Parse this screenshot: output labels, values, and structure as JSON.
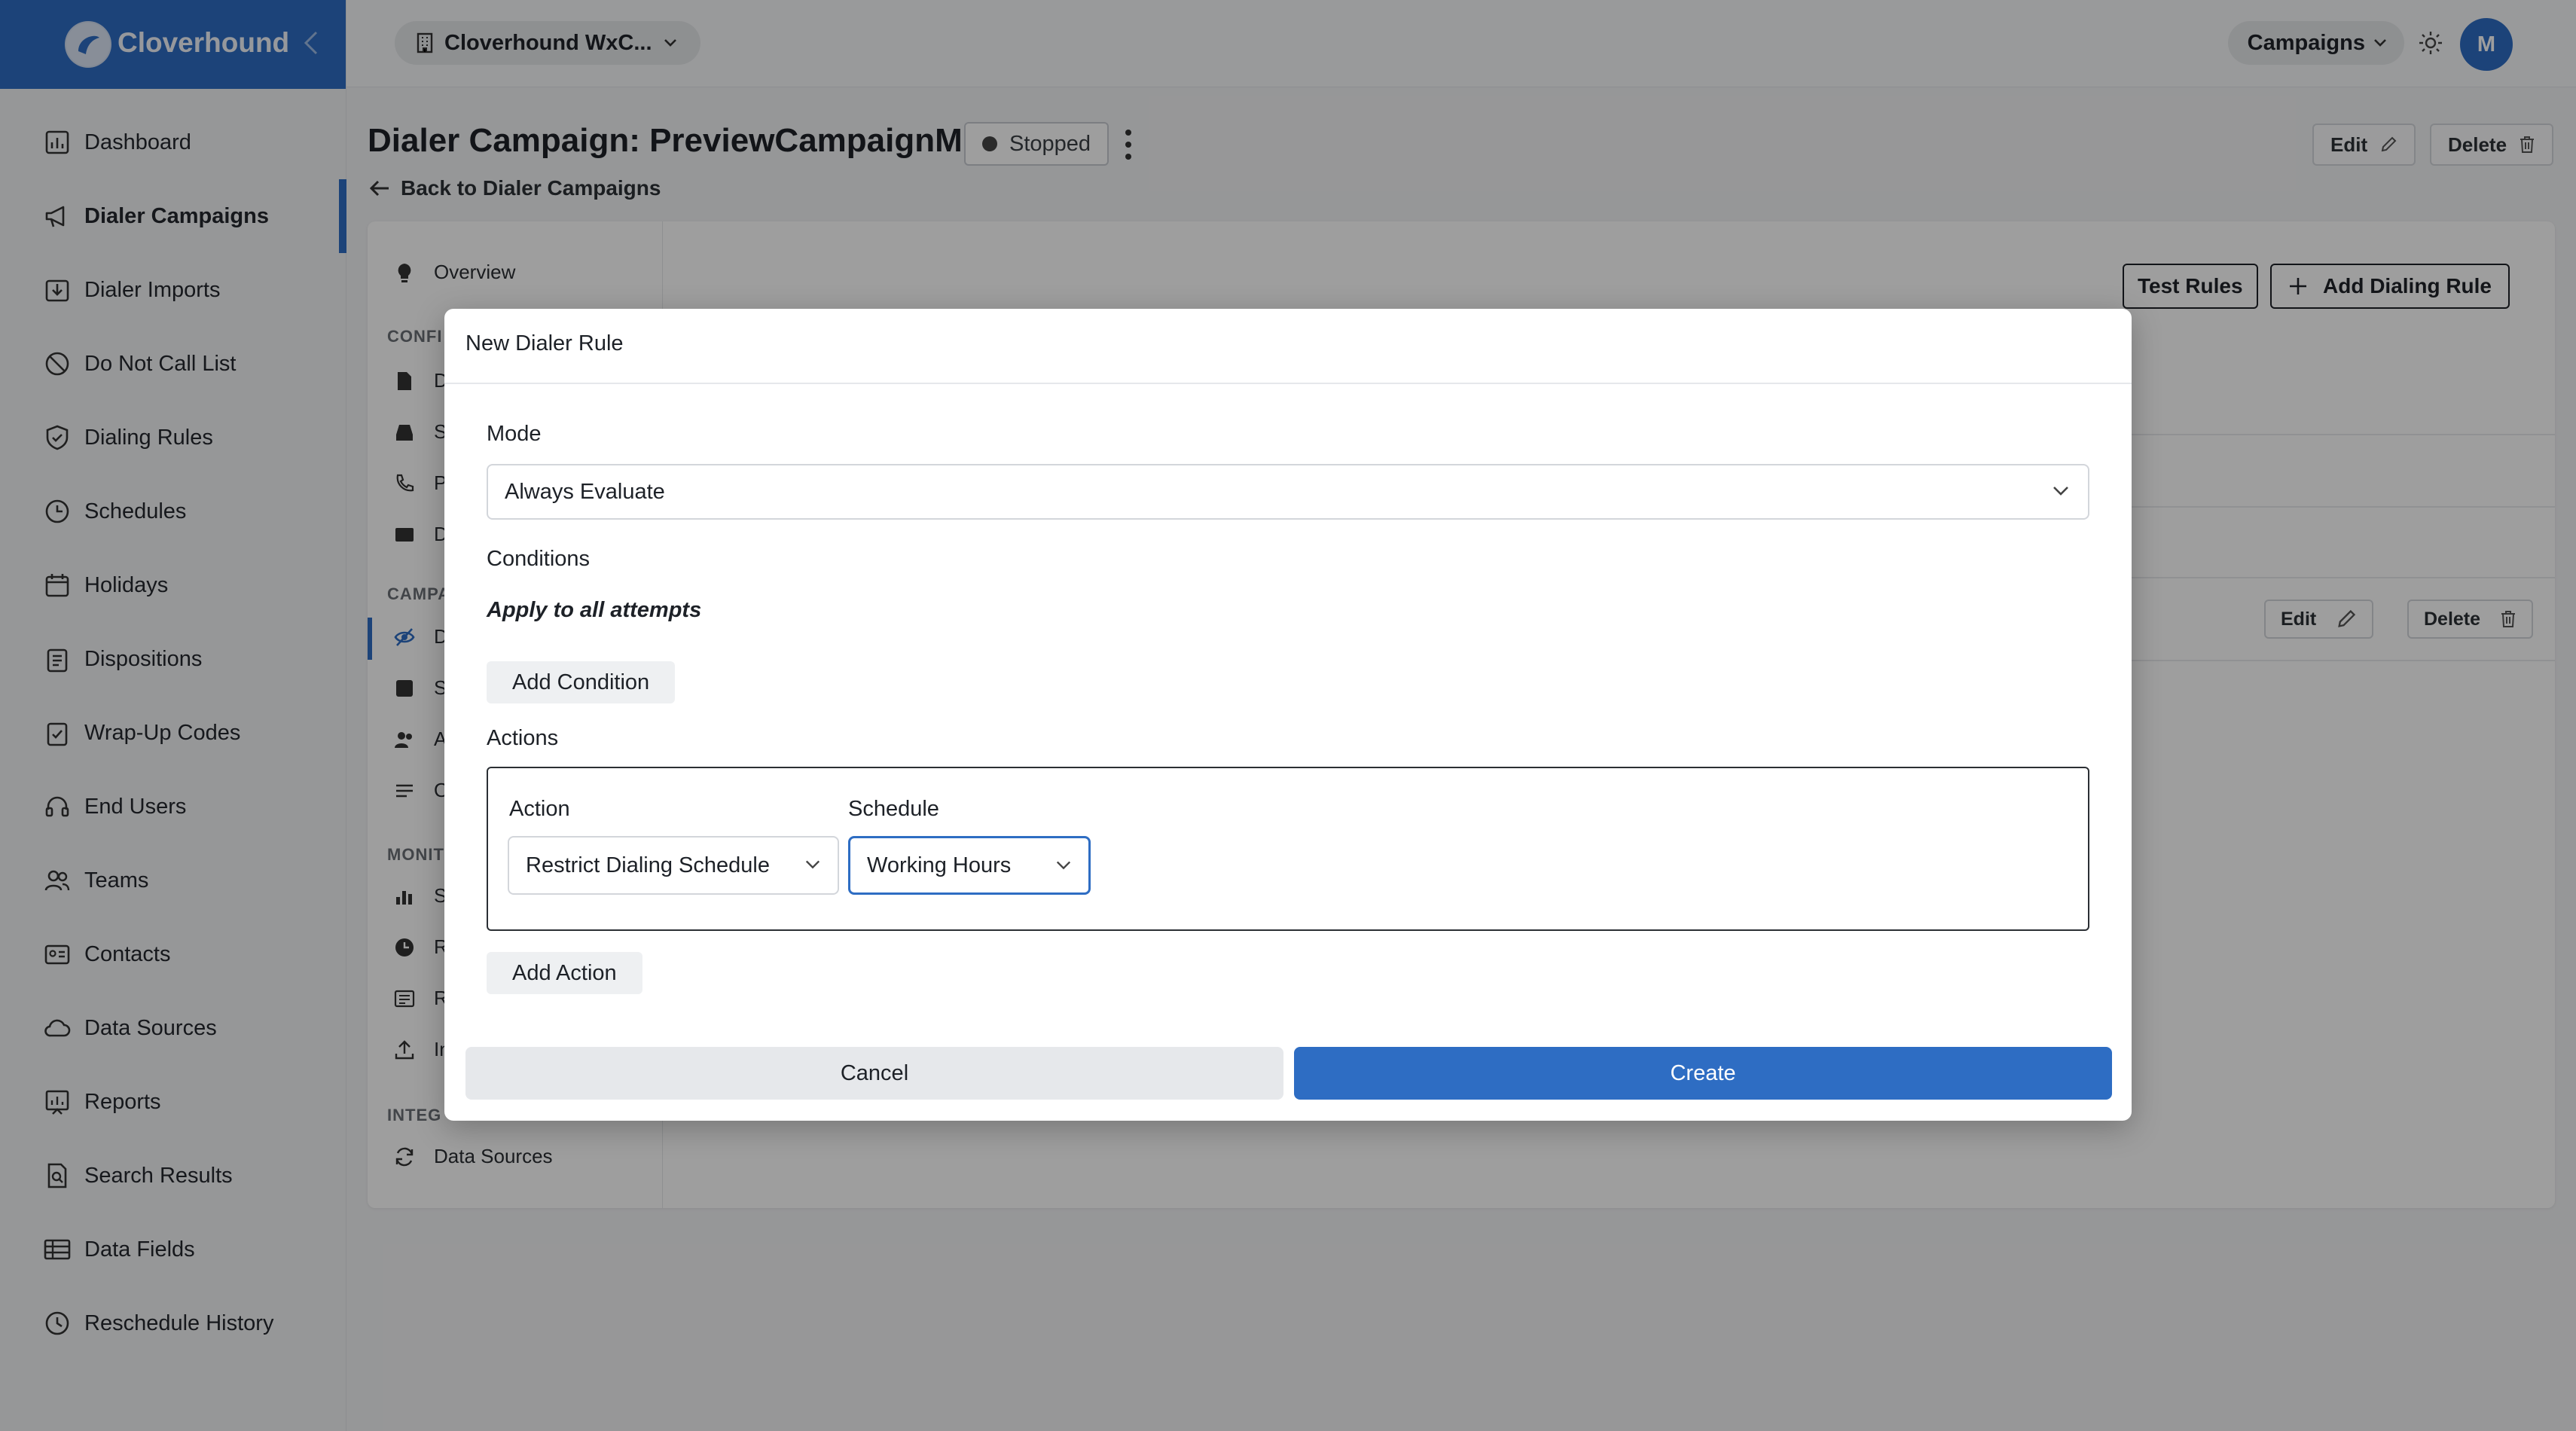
{
  "brand": {
    "name": "Cloverhound",
    "logo_icon": "clover-logo-icon",
    "collapse_icon": "chevron-left-icon"
  },
  "sidebar": {
    "items": [
      {
        "label": "Dashboard",
        "icon": "dashboard-icon"
      },
      {
        "label": "Dialer Campaigns",
        "icon": "megaphone-icon",
        "active": true
      },
      {
        "label": "Dialer Imports",
        "icon": "import-icon"
      },
      {
        "label": "Do Not Call List",
        "icon": "block-icon"
      },
      {
        "label": "Dialing Rules",
        "icon": "shield-icon"
      },
      {
        "label": "Schedules",
        "icon": "clock-icon"
      },
      {
        "label": "Holidays",
        "icon": "calendar-icon"
      },
      {
        "label": "Dispositions",
        "icon": "clipboard-icon"
      },
      {
        "label": "Wrap-Up Codes",
        "icon": "clipboard-check-icon"
      },
      {
        "label": "End Users",
        "icon": "headset-icon"
      },
      {
        "label": "Teams",
        "icon": "team-icon"
      },
      {
        "label": "Contacts",
        "icon": "contact-card-icon"
      },
      {
        "label": "Data Sources",
        "icon": "cloud-icon"
      },
      {
        "label": "Reports",
        "icon": "report-icon"
      },
      {
        "label": "Search Results",
        "icon": "search-doc-icon"
      },
      {
        "label": "Data Fields",
        "icon": "table-icon"
      },
      {
        "label": "Reschedule History",
        "icon": "history-icon"
      }
    ]
  },
  "topbar": {
    "org_label": "Cloverhound WxC...",
    "campaigns_label": "Campaigns",
    "avatar_initial": "M",
    "theme_icon": "sun-icon"
  },
  "page": {
    "title": "Dialer Campaign: PreviewCampaignM",
    "status": "Stopped",
    "back_link": "Back to Dialer Campaigns",
    "edit_label": "Edit",
    "delete_label": "Delete"
  },
  "subnav": {
    "overview": "Overview",
    "data_sources": "Data Sources",
    "section_config": "CONFI",
    "section_campaign": "CAMPA",
    "section_monitor": "MONIT",
    "section_integrations": "INTEG",
    "truncated": [
      "D",
      "S",
      "P",
      "D",
      "D",
      "S",
      "A",
      "O",
      "S",
      "R",
      "R",
      "In"
    ]
  },
  "content": {
    "test_rules_label": "Test Rules",
    "add_rule_label": "Add Dialing Rule",
    "row_edit_label": "Edit",
    "row_delete_label": "Delete"
  },
  "modal": {
    "title": "New Dialer Rule",
    "mode_label": "Mode",
    "mode_value": "Always Evaluate",
    "conditions_label": "Conditions",
    "apply_text": "Apply to all attempts",
    "add_condition_label": "Add Condition",
    "actions_label": "Actions",
    "action_label": "Action",
    "action_value": "Restrict Dialing Schedule",
    "schedule_label": "Schedule",
    "schedule_value": "Working Hours",
    "add_action_label": "Add Action",
    "cancel_label": "Cancel",
    "create_label": "Create"
  },
  "colors": {
    "brand": "#2e6dc3",
    "overlay": "#00000061"
  }
}
